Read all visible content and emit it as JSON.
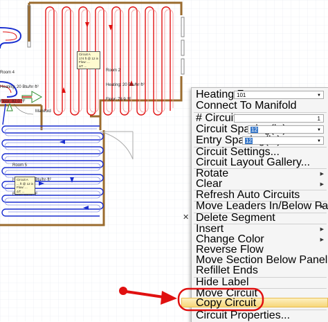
{
  "floorplan": {
    "room4": {
      "name": "Room 4",
      "heating": "Heating: 20 Btu/hr·ft²",
      "floor": "Floor: 82.0 °F"
    },
    "room2": {
      "name": "Room 2",
      "heating": "Heating: 20 Btu/hr·ft²",
      "floor": "Floor: 78.9 °F"
    },
    "room5": {
      "name": "Room 5",
      "heating": "Heating: 20 Btu/hr·ft²",
      "floor": "Floor: 82.0 °F"
    },
    "manifold_label": "Manifold",
    "circuit_tag_1": "Circuit A\n174 ft @ 12 in\nFlow: ...\nΔT: ...",
    "circuit_tag_2": "Circuit A\n... ft @ 12 in\nFlow: ...\nΔT: ..."
  },
  "colors": {
    "red_circuit": "#e01010",
    "blue_circuit": "#1a2fd0",
    "wall": "#9a6b2e",
    "menu_highlight": "#f7d77a",
    "annotation": "#e01010"
  },
  "menu": {
    "heating_zone_label": "Heating Zone:",
    "heating_zone_value": "101",
    "connect": "Connect To Manifold",
    "circuits_label": "# Circuits",
    "circuits_value": "1",
    "spacing_label": "Circuit Spacing(in):",
    "spacing_value": "12",
    "entry_label": "Entry Spacing(in):",
    "entry_value": "12",
    "settings": "Circuit Settings...",
    "gallery": "Circuit Layout Gallery...",
    "rotate": "Rotate",
    "clear": "Clear",
    "refresh": "Refresh Auto Circuits",
    "move_leaders": "Move Leaders In/Below Panel",
    "delete_segment": "Delete Segment",
    "insert": "Insert",
    "change_color": "Change Color",
    "reverse_flow": "Reverse Flow",
    "move_section": "Move Section Below Panel",
    "refillet": "Refillet Ends",
    "hide_label": "Hide Label",
    "move_circuit": "Move Circuit",
    "copy_circuit": "Copy Circuit",
    "properties": "Circuit Properties..."
  },
  "icons": {
    "close": "close-icon",
    "submenu": "chevron-right-icon",
    "dropdown": "chevron-down-icon"
  }
}
